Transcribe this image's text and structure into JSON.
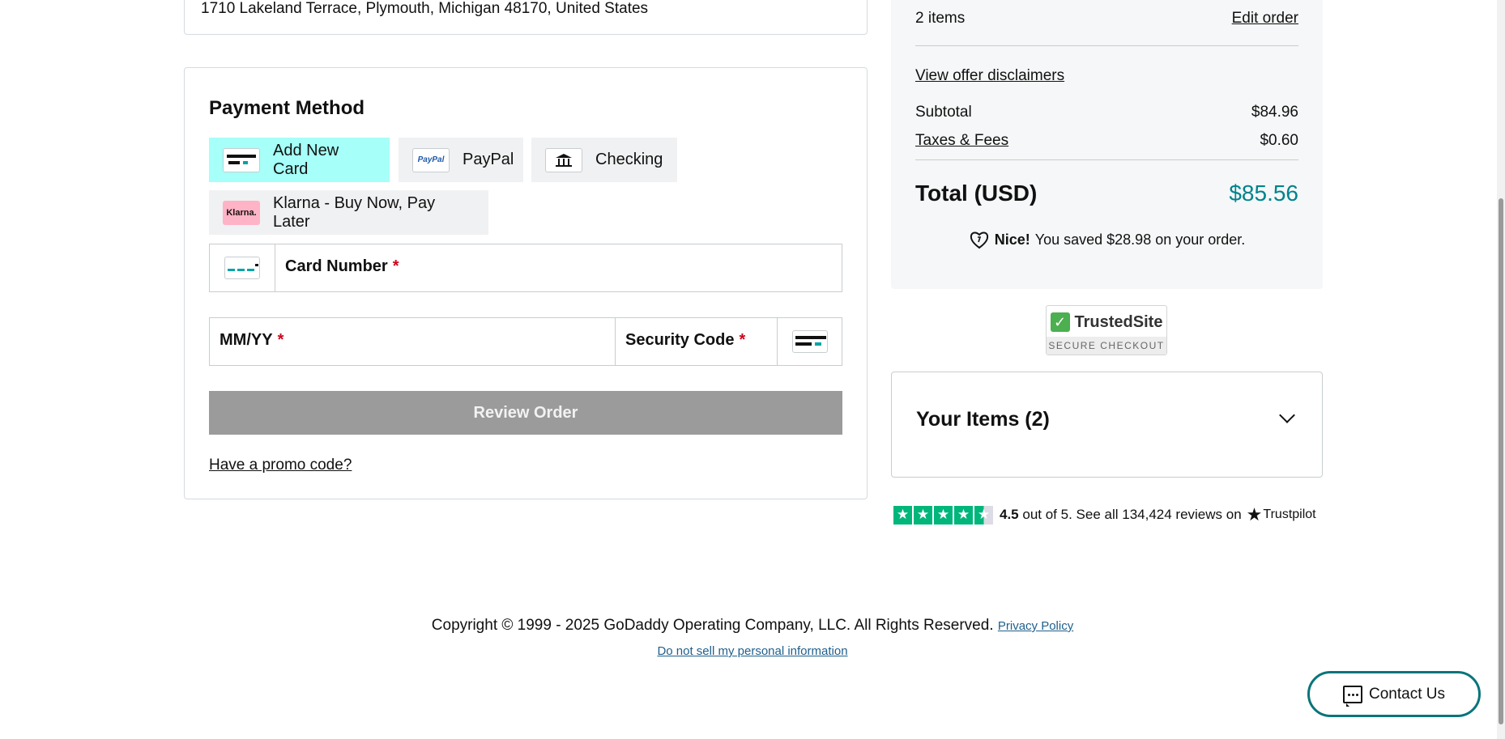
{
  "shipping": {
    "address": "1710 Lakeland Terrace, Plymouth, Michigan 48170, United States"
  },
  "payment": {
    "title": "Payment Method",
    "options": [
      {
        "label": "Add New Card",
        "icon": "credit-card-icon",
        "selected": true
      },
      {
        "label": "PayPal",
        "icon": "paypal-icon",
        "icon_text": "PayPal",
        "selected": false
      },
      {
        "label": "Checking",
        "icon": "bank-icon",
        "selected": false
      },
      {
        "label": "Klarna - Buy Now, Pay Later",
        "icon": "klarna-icon",
        "icon_text": "Klarna.",
        "selected": false
      }
    ],
    "fields": {
      "card_number": {
        "label": "Card Number",
        "required_mark": "*"
      },
      "expiry": {
        "label": "MM/YY",
        "required_mark": "*"
      },
      "security_code": {
        "label": "Security Code",
        "required_mark": "*"
      }
    },
    "review_button": "Review Order",
    "promo_link": "Have a promo code?"
  },
  "summary": {
    "items_count": "2 items",
    "edit_order": "Edit order",
    "offer_disclaimers": "View offer disclaimers",
    "subtotal_label": "Subtotal",
    "subtotal_value": "$84.96",
    "taxes_label": "Taxes & Fees",
    "taxes_value": "$0.60",
    "total_label": "Total (USD)",
    "total_value": "$85.56",
    "savings_prefix": "Nice!",
    "savings_text": "You saved $28.98 on your order."
  },
  "trusted_site": {
    "title": "TrustedSite",
    "subtitle": "SECURE CHECKOUT"
  },
  "items_panel": {
    "title": "Your Items (2)"
  },
  "trustpilot": {
    "rating": "4.5",
    "text": "out of 5. See all 134,424 reviews on",
    "brand": "Trustpilot",
    "stars": 4.5
  },
  "footer": {
    "copyright": "Copyright © 1999 - 2025 GoDaddy Operating Company, LLC. All Rights Reserved.",
    "privacy_link": "Privacy Policy",
    "do_not_sell_link": "Do not sell my personal information"
  },
  "contact_button": "Contact Us",
  "colors": {
    "selected_option_bg": "#a6fff8",
    "total_accent": "#00838c",
    "review_button_bg": "#9b9b9b",
    "trustpilot_green": "#00b67a",
    "contact_border": "#09757a"
  }
}
